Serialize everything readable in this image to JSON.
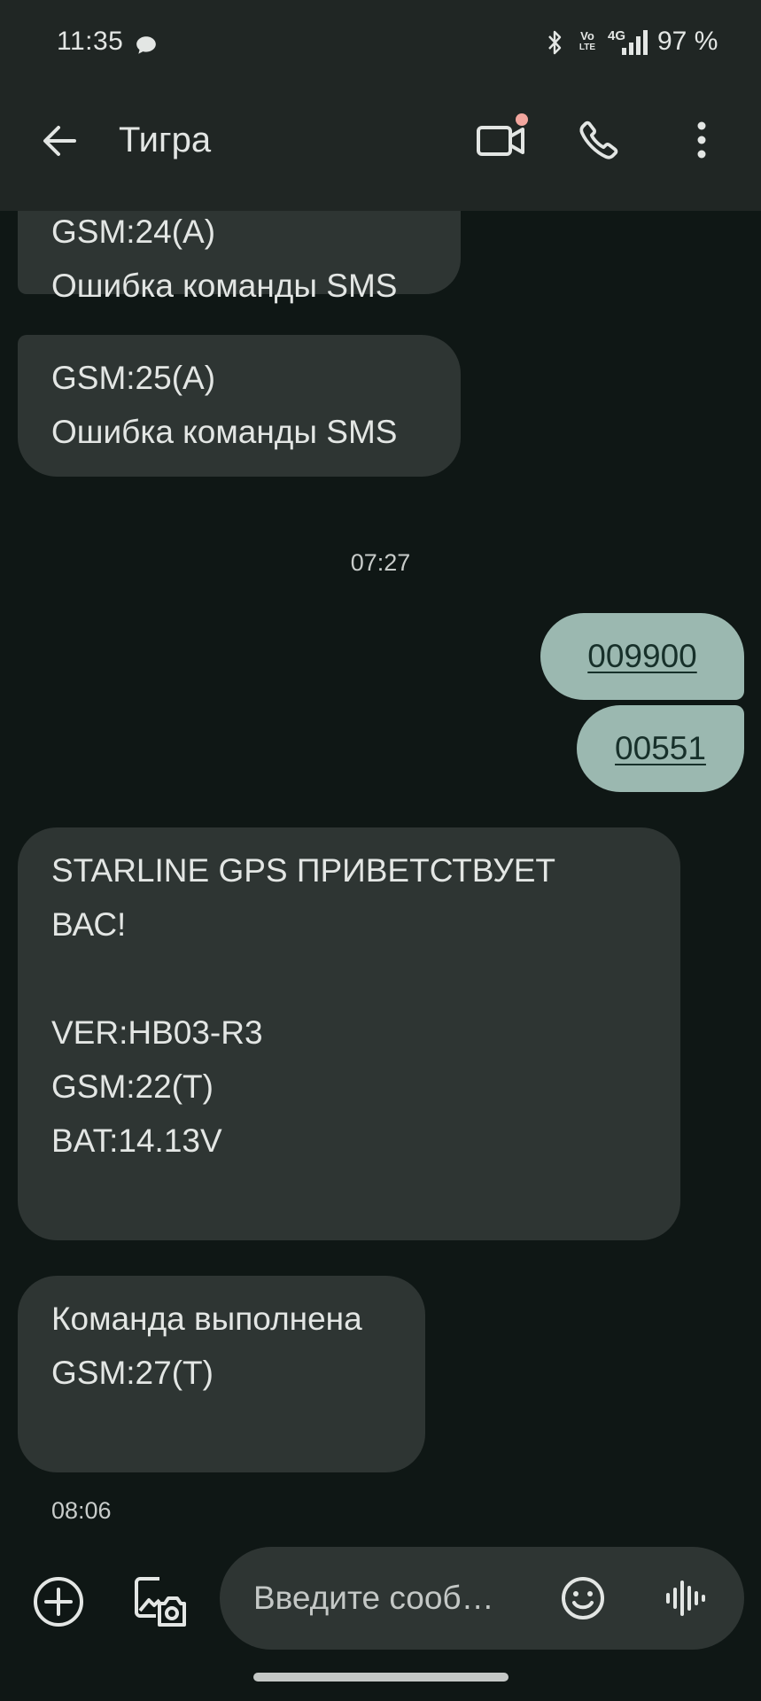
{
  "status_bar": {
    "time": "11:35",
    "volte_top": "Vo",
    "volte_bottom": "LTE",
    "network": "4G",
    "battery": "97 %"
  },
  "app_bar": {
    "contact_name": "Тигра"
  },
  "messages": [
    {
      "direction": "in",
      "text": "GSM:24(A)\nОшибка команды SMS"
    },
    {
      "direction": "in",
      "text": "GSM:25(A)\nОшибка команды SMS"
    },
    {
      "type": "timestamp",
      "text": "07:27"
    },
    {
      "direction": "out",
      "text": "009900"
    },
    {
      "direction": "out",
      "text": "00551"
    },
    {
      "direction": "in",
      "text": "STARLINE GPS ПРИВЕТСТВУЕТ\nВАС!\n\nVER:HB03-R3\nGSM:22(T)\nBAT:14.13V"
    },
    {
      "direction": "in",
      "text": "Команда выполнена\nGSM:27(T)"
    },
    {
      "type": "timestamp",
      "text": "08:06"
    }
  ],
  "composer": {
    "placeholder": "Введите сооб…"
  },
  "colors": {
    "bar_background": "#202624",
    "screen_background": "#0f1715",
    "incoming_bubble": "#2e3533",
    "outgoing_bubble": "#9bb8b0",
    "notification_dot": "#f2a69e"
  }
}
